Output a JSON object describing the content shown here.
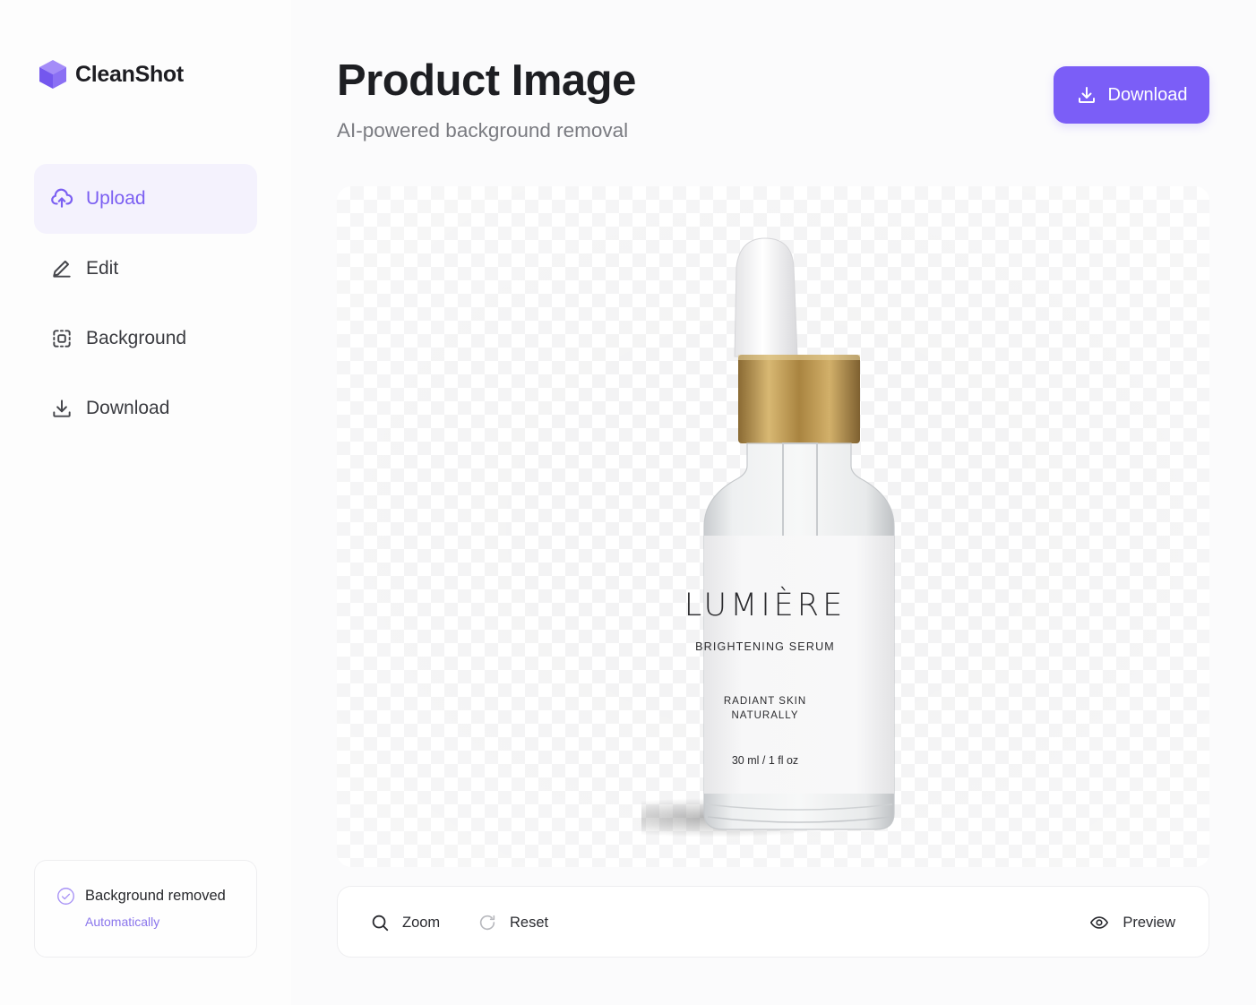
{
  "app": {
    "name": "CleanShot"
  },
  "sidebar": {
    "items": [
      {
        "label": "Upload",
        "icon": "cloud-upload-icon",
        "active": true
      },
      {
        "label": "Edit",
        "icon": "pencil-icon",
        "active": false
      },
      {
        "label": "Background",
        "icon": "background-select-icon",
        "active": false
      },
      {
        "label": "Download",
        "icon": "download-icon",
        "active": false
      }
    ],
    "status": {
      "title": "Background removed",
      "subtitle": "Automatically",
      "icon": "check-circle-icon"
    }
  },
  "header": {
    "title": "Product Image",
    "subtitle": "AI-powered background removal",
    "download_label": "Download"
  },
  "product_label": {
    "brand": "LUMIÈRE",
    "name": "BRIGHTENING SERUM",
    "tagline_line1": "RADIANT SKIN",
    "tagline_line2": "NATURALLY",
    "volume": "30 ml / 1 fl oz"
  },
  "toolbar": {
    "zoom_label": "Zoom",
    "reset_label": "Reset",
    "preview_label": "Preview"
  },
  "colors": {
    "accent": "#7b5ef7",
    "accent_light": "#f4f2fd",
    "gold": "#b48e48"
  }
}
